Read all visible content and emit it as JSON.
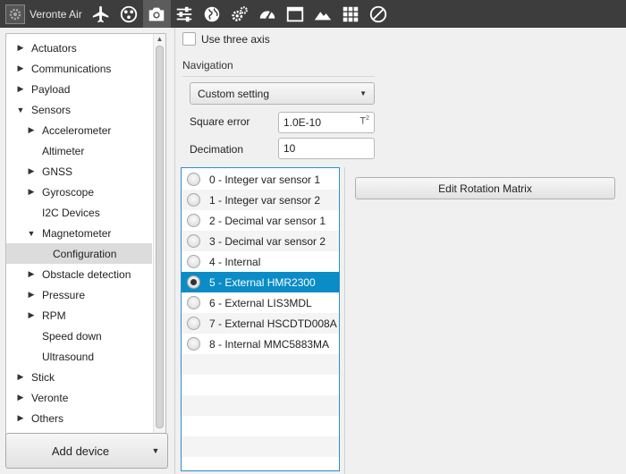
{
  "app": {
    "title": "Veronte Air",
    "logo_icon": "gear-logo-icon"
  },
  "toolbar": {
    "icons": [
      "airplane-icon",
      "drone-icon",
      "camera-icon",
      "sliders-icon",
      "globe-icon",
      "gears-icon",
      "dashboard-gauge-icon",
      "window-icon",
      "mountain-icon",
      "grid-icon",
      "disabled-icon"
    ],
    "active": "camera-icon"
  },
  "tree": {
    "items": [
      {
        "label": "Actuators",
        "level": 0,
        "expander": "collapsed"
      },
      {
        "label": "Communications",
        "level": 0,
        "expander": "collapsed"
      },
      {
        "label": "Payload",
        "level": 0,
        "expander": "collapsed"
      },
      {
        "label": "Sensors",
        "level": 0,
        "expander": "expanded"
      },
      {
        "label": "Accelerometer",
        "level": 1,
        "expander": "collapsed"
      },
      {
        "label": "Altimeter",
        "level": 1,
        "expander": "none"
      },
      {
        "label": "GNSS",
        "level": 1,
        "expander": "collapsed"
      },
      {
        "label": "Gyroscope",
        "level": 1,
        "expander": "collapsed"
      },
      {
        "label": "I2C Devices",
        "level": 1,
        "expander": "none"
      },
      {
        "label": "Magnetometer",
        "level": 1,
        "expander": "expanded"
      },
      {
        "label": "Configuration",
        "level": 2,
        "expander": "none",
        "selected": true
      },
      {
        "label": "Obstacle detection",
        "level": 1,
        "expander": "collapsed"
      },
      {
        "label": "Pressure",
        "level": 1,
        "expander": "collapsed"
      },
      {
        "label": "RPM",
        "level": 1,
        "expander": "collapsed"
      },
      {
        "label": "Speed down",
        "level": 1,
        "expander": "none"
      },
      {
        "label": "Ultrasound",
        "level": 1,
        "expander": "none"
      },
      {
        "label": "Stick",
        "level": 0,
        "expander": "collapsed"
      },
      {
        "label": "Veronte",
        "level": 0,
        "expander": "collapsed"
      },
      {
        "label": "Others",
        "level": 0,
        "expander": "collapsed"
      }
    ]
  },
  "add_device": {
    "label": "Add device"
  },
  "config": {
    "three_axis_label": "Use three axis",
    "three_axis_checked": false,
    "navigation_title": "Navigation",
    "navigation_select": "Custom setting",
    "square_error_label": "Square error",
    "square_error_value": "1.0E-10",
    "square_error_unit": "T",
    "square_error_unit_exp": "2",
    "decimation_label": "Decimation",
    "decimation_value": "10"
  },
  "sources": {
    "items": [
      "0 - Integer var sensor 1",
      "1 - Integer var sensor 2",
      "2 - Decimal var sensor 1",
      "3 - Decimal var sensor 2",
      "4 - Internal",
      "5 - External HMR2300",
      "6 - External LIS3MDL",
      "7 - External HSCDTD008A",
      "8 - Internal MMC5883MA"
    ],
    "selected_index": 5
  },
  "edit_rotation_label": "Edit Rotation Matrix"
}
